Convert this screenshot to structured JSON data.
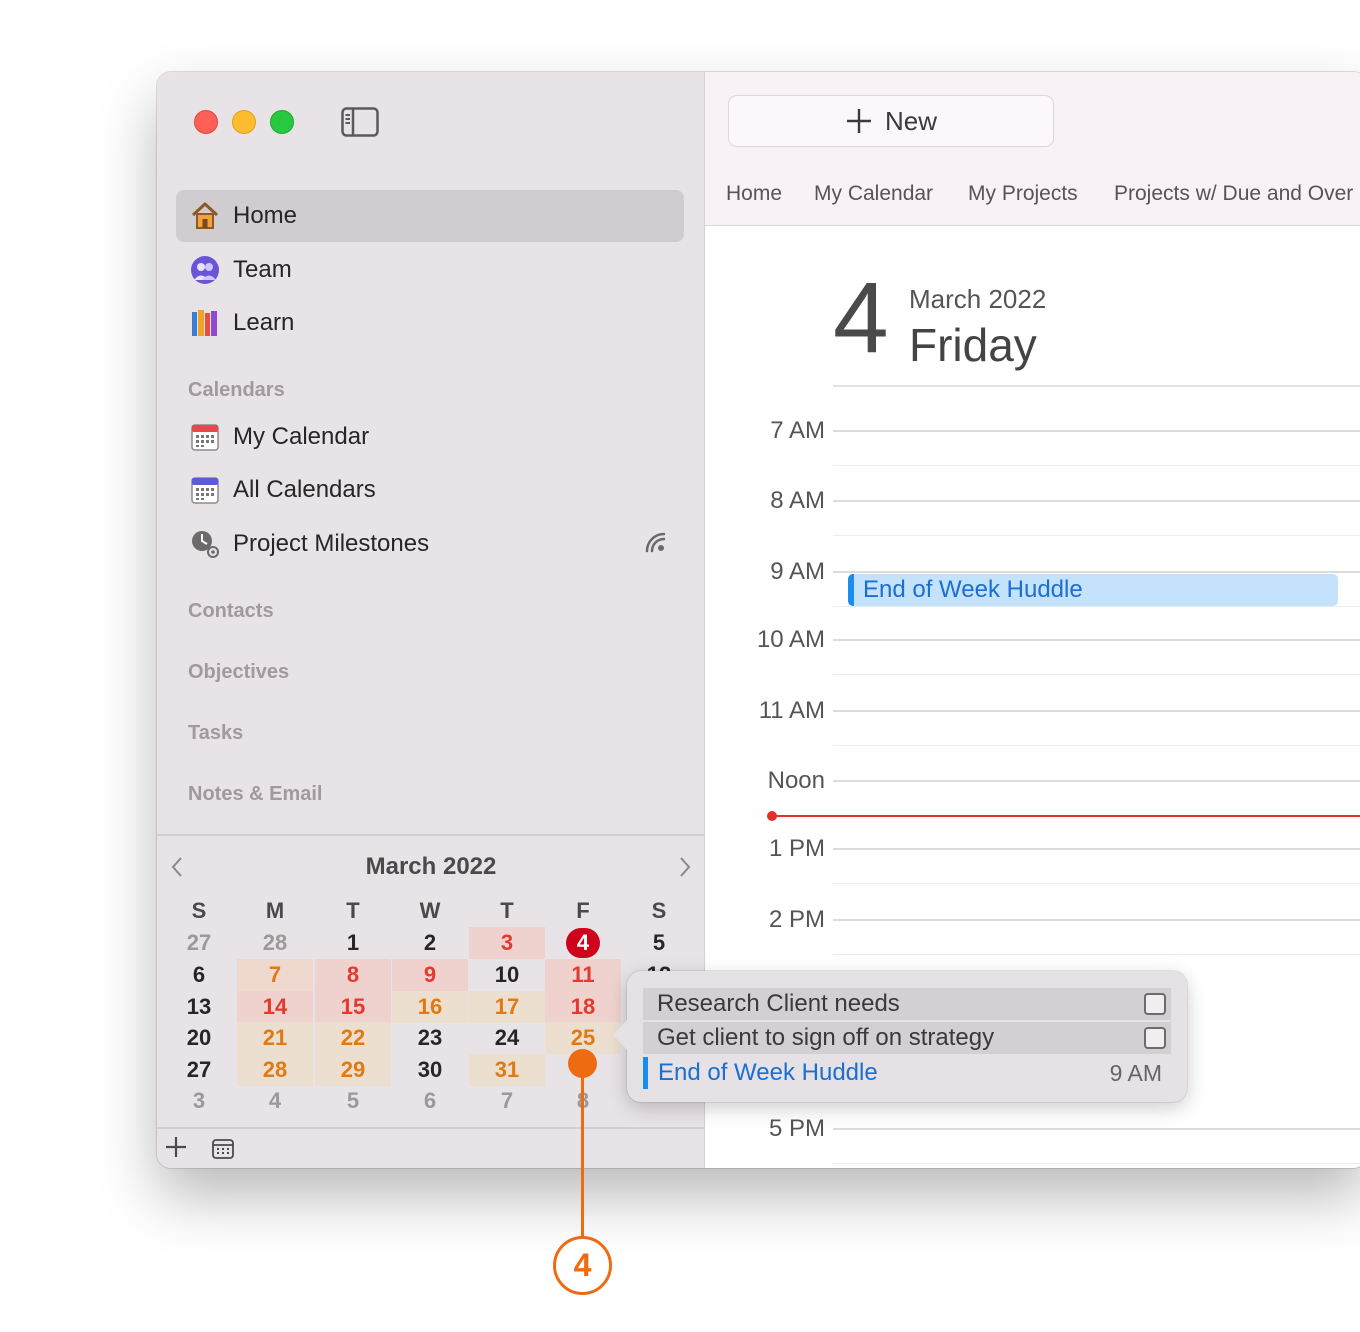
{
  "sidebar": {
    "items": [
      {
        "label": "Home",
        "icon": "home-icon"
      },
      {
        "label": "Team",
        "icon": "team-icon"
      },
      {
        "label": "Learn",
        "icon": "learn-icon"
      }
    ],
    "calendars_header": "Calendars",
    "calendars": [
      {
        "label": "My Calendar",
        "icon": "calendar-icon"
      },
      {
        "label": "All Calendars",
        "icon": "all-calendars-icon"
      },
      {
        "label": "Project Milestones",
        "icon": "milestones-icon"
      }
    ],
    "sections": [
      "Contacts",
      "Objectives",
      "Tasks",
      "Notes & Email"
    ]
  },
  "mini_calendar": {
    "title": "March 2022",
    "days_of_week": [
      "S",
      "M",
      "T",
      "W",
      "T",
      "F",
      "S"
    ],
    "weeks": [
      [
        "27",
        "28",
        "1",
        "2",
        "3",
        "4",
        "5"
      ],
      [
        "6",
        "7",
        "8",
        "9",
        "10",
        "11",
        "12"
      ],
      [
        "13",
        "14",
        "15",
        "16",
        "17",
        "18",
        ""
      ],
      [
        "20",
        "21",
        "22",
        "23",
        "24",
        "25",
        ""
      ],
      [
        "27",
        "28",
        "29",
        "30",
        "31",
        "",
        ""
      ],
      [
        "3",
        "4",
        "5",
        "6",
        "7",
        "8",
        ""
      ]
    ],
    "today": "4"
  },
  "toolbar": {
    "new_label": "New",
    "tabs": [
      "Home",
      "My Calendar",
      "My Projects",
      "Projects w/ Due and Over"
    ]
  },
  "day_view": {
    "day_number": "4",
    "month_year": "March 2022",
    "weekday": "Friday",
    "hours": [
      "7 AM",
      "8 AM",
      "9 AM",
      "10 AM",
      "11 AM",
      "Noon",
      "1 PM",
      "2 PM",
      "5 PM"
    ],
    "event": "End of Week Huddle"
  },
  "popover": {
    "tasks": [
      "Research Client needs",
      "Get client to sign off on strategy"
    ],
    "event_title": "End of Week Huddle",
    "event_time": "9 AM"
  },
  "callout": {
    "number": "4",
    "color": "#ee6b12"
  },
  "colors": {
    "accent_blue": "#1b8cf0",
    "today_red": "#d0021b",
    "now_line": "#e0312b"
  }
}
